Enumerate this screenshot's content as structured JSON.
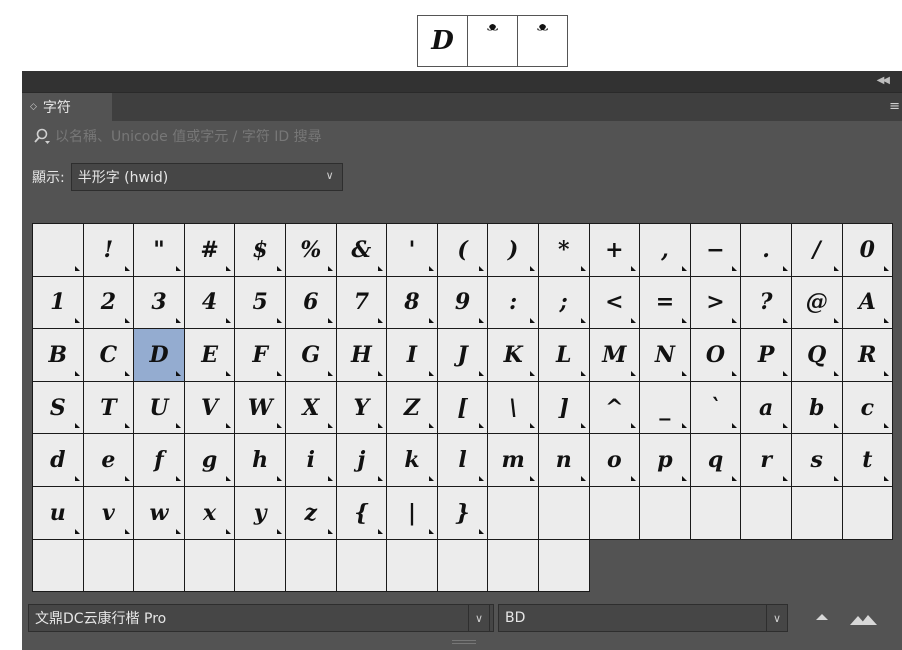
{
  "preview": {
    "glyphs": [
      "D",
      "ᵜ",
      "ᵜ"
    ]
  },
  "panel": {
    "tab_label": "字符",
    "search": {
      "placeholder": "以名稱、Unicode 值或字元 / 字符 ID 搜尋"
    },
    "show": {
      "label": "顯示:",
      "value": "半形字 (hwid)"
    },
    "glyphs": [
      " ",
      "!",
      "\"",
      "#",
      "$",
      "%",
      "&",
      "'",
      "(",
      ")",
      "*",
      "+",
      ",",
      "−",
      ".",
      "/",
      "0",
      "1",
      "2",
      "3",
      "4",
      "5",
      "6",
      "7",
      "8",
      "9",
      ":",
      ";",
      "<",
      "=",
      ">",
      "?",
      "@",
      "A",
      "B",
      "C",
      "D",
      "E",
      "F",
      "G",
      "H",
      "I",
      "J",
      "K",
      "L",
      "M",
      "N",
      "O",
      "P",
      "Q",
      "R",
      "S",
      "T",
      "U",
      "V",
      "W",
      "X",
      "Y",
      "Z",
      "[",
      "\\",
      "]",
      "^",
      "_",
      "`",
      "a",
      "b",
      "c",
      "d",
      "e",
      "f",
      "g",
      "h",
      "i",
      "j",
      "k",
      "l",
      "m",
      "n",
      "o",
      "p",
      "q",
      "r",
      "s",
      "t",
      "u",
      "v",
      "w",
      "x",
      "y",
      "z",
      "{",
      "|",
      "}",
      "",
      "",
      "",
      "",
      "",
      "",
      "",
      "",
      "",
      "",
      "",
      "",
      "",
      "",
      "",
      "",
      "",
      "",
      ""
    ],
    "selected_glyph": "D",
    "font": {
      "family": "文鼎DC云康行楷 Pro",
      "style": "BD"
    }
  },
  "colors": {
    "panel_bg": "#535353",
    "cell_bg": "#ececec",
    "selected_bg": "#94acd0"
  }
}
